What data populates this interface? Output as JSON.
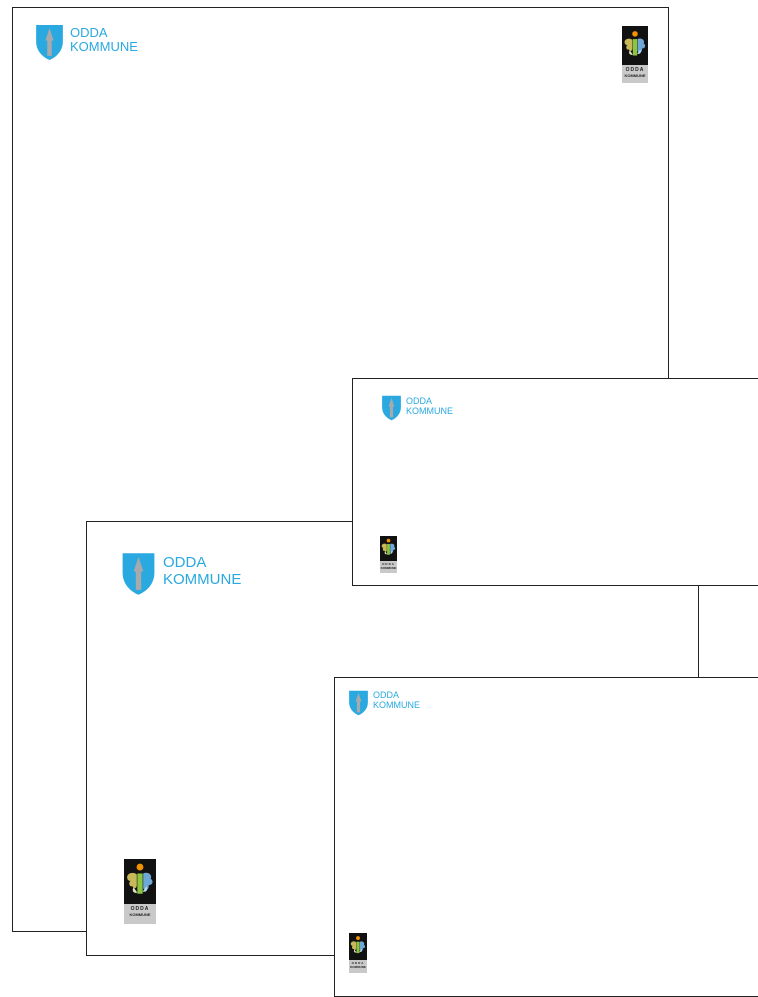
{
  "brand": {
    "line1": "ODDA",
    "line2": "KOMMUNE",
    "mark_text": "ODDA",
    "mark_subtext": "KOMMUNE",
    "text_color": "#29a9e0",
    "shield_color": "#29a9e0",
    "arrow_color": "#a7a9ac"
  },
  "icons": {
    "shield": "coat-of-arms-shield-icon",
    "mark": "odda-flower-mark-icon"
  },
  "sheets": [
    {
      "id": "letter",
      "name": "letterhead"
    },
    {
      "id": "compl",
      "name": "compliment-card"
    },
    {
      "id": "env-c5",
      "name": "envelope-landscape"
    },
    {
      "id": "env-a4",
      "name": "envelope-large"
    }
  ]
}
